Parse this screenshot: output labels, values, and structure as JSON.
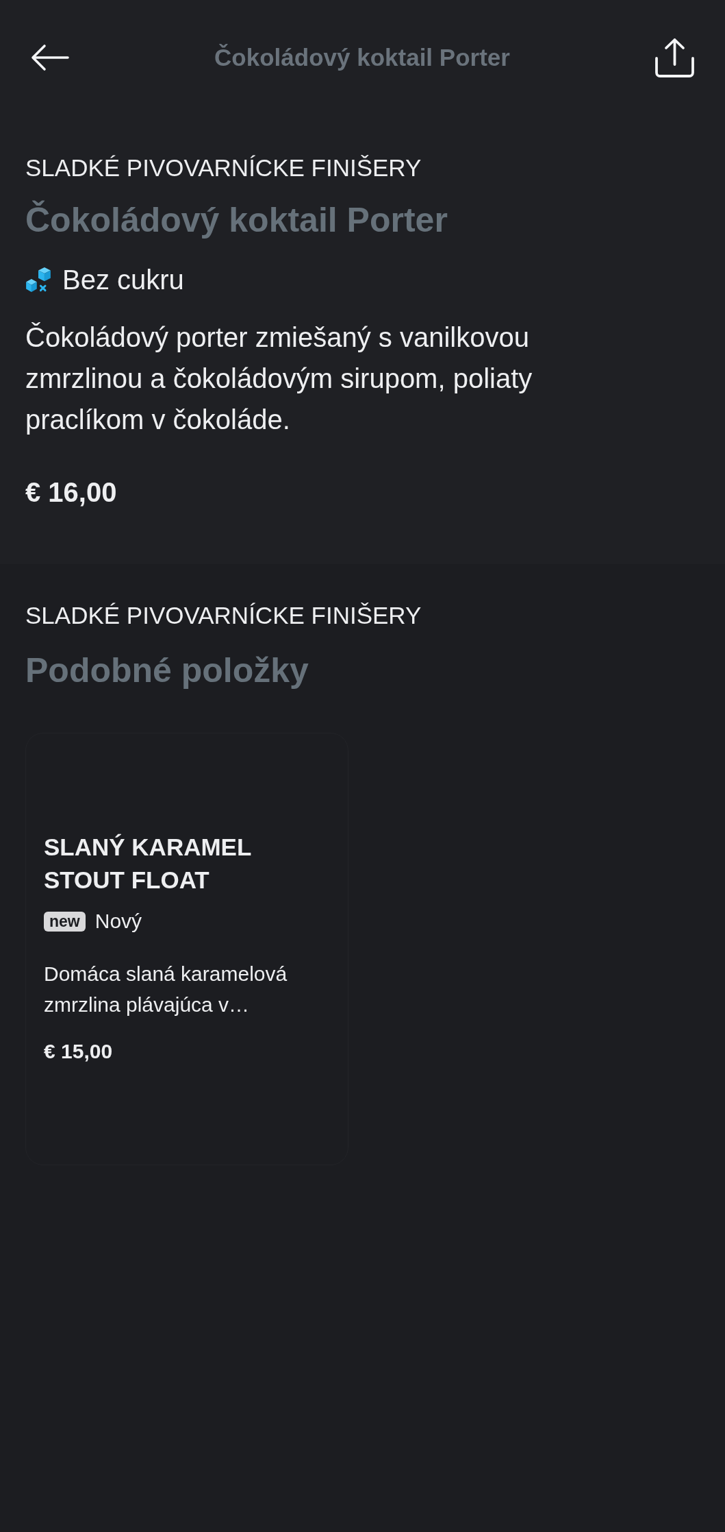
{
  "header": {
    "title": "Čokoládový koktail Porter"
  },
  "product": {
    "category": "SLADKÉ PIVOVARNÍCKE FINIŠERY",
    "name": "Čokoládový koktail Porter",
    "tags": [
      {
        "kind": "sugar_free",
        "label": "Bez cukru"
      }
    ],
    "description": "Čokoládový porter zmiešaný s vanilkovou zmrzlinou a čokoládovým sirupom, poliaty praclíkom v čokoláde.",
    "price": "€ 16,00"
  },
  "similar": {
    "category": "SLADKÉ PIVOVARNÍCKE FINIŠERY",
    "heading": "Podobné položky",
    "items": [
      {
        "name": "SLANÝ KARAMEL STOUT FLOAT",
        "tags": [
          {
            "kind": "new",
            "badge": "new",
            "label": "Nový"
          }
        ],
        "description": "Domáca slaná karamelová zmrzlina plávajúca v…",
        "price": "€ 15,00"
      }
    ]
  }
}
